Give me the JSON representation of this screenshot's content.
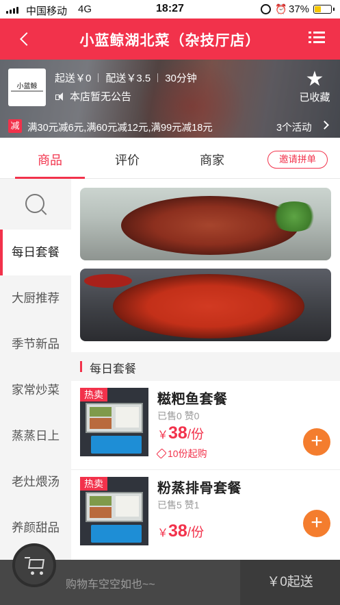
{
  "status_bar": {
    "carrier": "中国移动",
    "network": "4G",
    "time": "18:27",
    "battery": "37%"
  },
  "header": {
    "title": "小蓝鲸湖北菜（杂技厅店）"
  },
  "shop": {
    "logo_text": "小蓝鲸",
    "min_order": "起送￥0",
    "delivery_fee": "配送￥3.5",
    "delivery_time": "30分钟",
    "notice": "本店暂无公告",
    "favorite_label": "已收藏",
    "promo_tag": "减",
    "promo_text": "满30元减6元,满60元减12元,满99元减18元",
    "activity_count": "3个活动"
  },
  "tabs": {
    "items": [
      "商品",
      "评价",
      "商家"
    ],
    "active": "商品",
    "invite_label": "邀请拼单"
  },
  "sidebar": {
    "categories": [
      "每日套餐",
      "大厨推荐",
      "季节新品",
      "家常炒菜",
      "蒸蒸日上",
      "老灶煨汤",
      "养颜甜品"
    ],
    "active": "每日套餐"
  },
  "section": {
    "title": "每日套餐"
  },
  "products": [
    {
      "badge": "热卖",
      "name": "糍粑鱼套餐",
      "sales": "已售0  赞0",
      "price_symbol": "￥",
      "price": "38",
      "unit": "/份",
      "min_qty": "10份起购"
    },
    {
      "badge": "热卖",
      "name": "粉蒸排骨套餐",
      "sales": "已售5  赞1",
      "price_symbol": "￥",
      "price": "38",
      "unit": "/份",
      "min_qty": ""
    }
  ],
  "cart": {
    "empty_text": "购物车空空如也~~",
    "checkout_label": "￥0起送"
  },
  "colors": {
    "brand": "#f2324b",
    "add_button": "#f47d2e"
  },
  "icons": [
    "back-icon",
    "menu-icon",
    "speaker-icon",
    "star-icon",
    "search-icon",
    "plus-icon",
    "cart-icon",
    "tag-icon",
    "chevron-right-icon"
  ]
}
